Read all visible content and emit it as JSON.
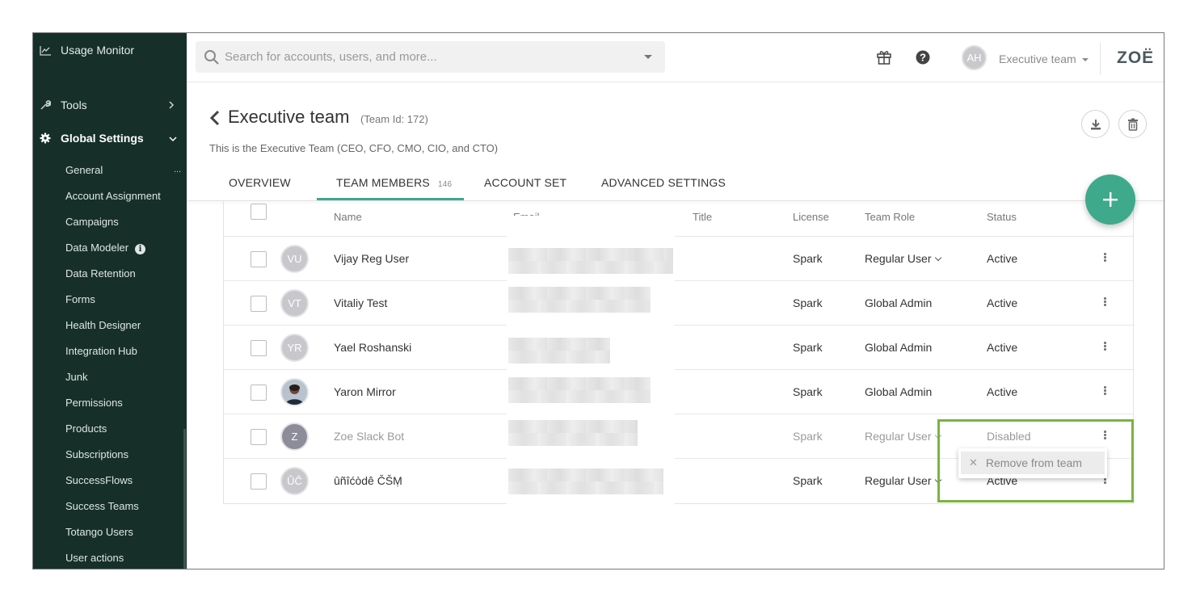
{
  "sidebar": {
    "usage_monitor": "Usage Monitor",
    "tools": "Tools",
    "global_settings": "Global Settings",
    "sub_dots": "...",
    "items": [
      {
        "label": "General"
      },
      {
        "label": "Account Assignment"
      },
      {
        "label": "Campaigns"
      },
      {
        "label": "Data Modeler"
      },
      {
        "label": "Data Retention"
      },
      {
        "label": "Forms"
      },
      {
        "label": "Health Designer"
      },
      {
        "label": "Integration Hub"
      },
      {
        "label": "Junk"
      },
      {
        "label": "Permissions"
      },
      {
        "label": "Products"
      },
      {
        "label": "Subscriptions"
      },
      {
        "label": "SuccessFlows"
      },
      {
        "label": "Success Teams"
      },
      {
        "label": "Totango Users"
      },
      {
        "label": "User actions"
      }
    ]
  },
  "header": {
    "search_placeholder": "Search for accounts, users, and more...",
    "user_initials": "AH",
    "team_selector": "Executive team",
    "logo": "ZOË"
  },
  "page": {
    "title": "Executive team",
    "team_id": "(Team Id: 172)",
    "description": "This is the Executive Team (CEO, CFO, CMO, CIO, and CTO)"
  },
  "tabs": [
    {
      "label": "OVERVIEW"
    },
    {
      "label": "TEAM MEMBERS",
      "count": "146",
      "active": true
    },
    {
      "label": "ACCOUNT SET"
    },
    {
      "label": "ADVANCED SETTINGS"
    }
  ],
  "table": {
    "columns": [
      "Name",
      "Email",
      "Title",
      "License",
      "Team Role",
      "Status"
    ],
    "rows": [
      {
        "initials": "VU",
        "name": "Vijay Reg User",
        "license": "Spark",
        "role": "Regular User",
        "status": "Active"
      },
      {
        "initials": "VT",
        "name": "Vitaliy Test",
        "license": "Spark",
        "role": "Global Admin",
        "status": "Active"
      },
      {
        "initials": "YR",
        "name": "Yael Roshanski",
        "license": "Spark",
        "role": "Global Admin",
        "status": "Active"
      },
      {
        "initials": "",
        "name": "Yaron Mirror",
        "license": "Spark",
        "role": "Global Admin",
        "status": "Active"
      },
      {
        "initials": "Z",
        "name": "Zoe Slack Bot",
        "license": "Spark",
        "role": "Regular User",
        "status": "Disabled"
      },
      {
        "initials": "ÛĈ",
        "name": "ûñîćòdê ČŠṂ",
        "license": "Spark",
        "role": "Regular User",
        "status": "Active"
      }
    ]
  },
  "context_menu": {
    "remove_label": "Remove from team"
  },
  "colors": {
    "sidebar_bg": "#163029",
    "accent": "#3fa98c",
    "highlight": "#7bb342"
  }
}
